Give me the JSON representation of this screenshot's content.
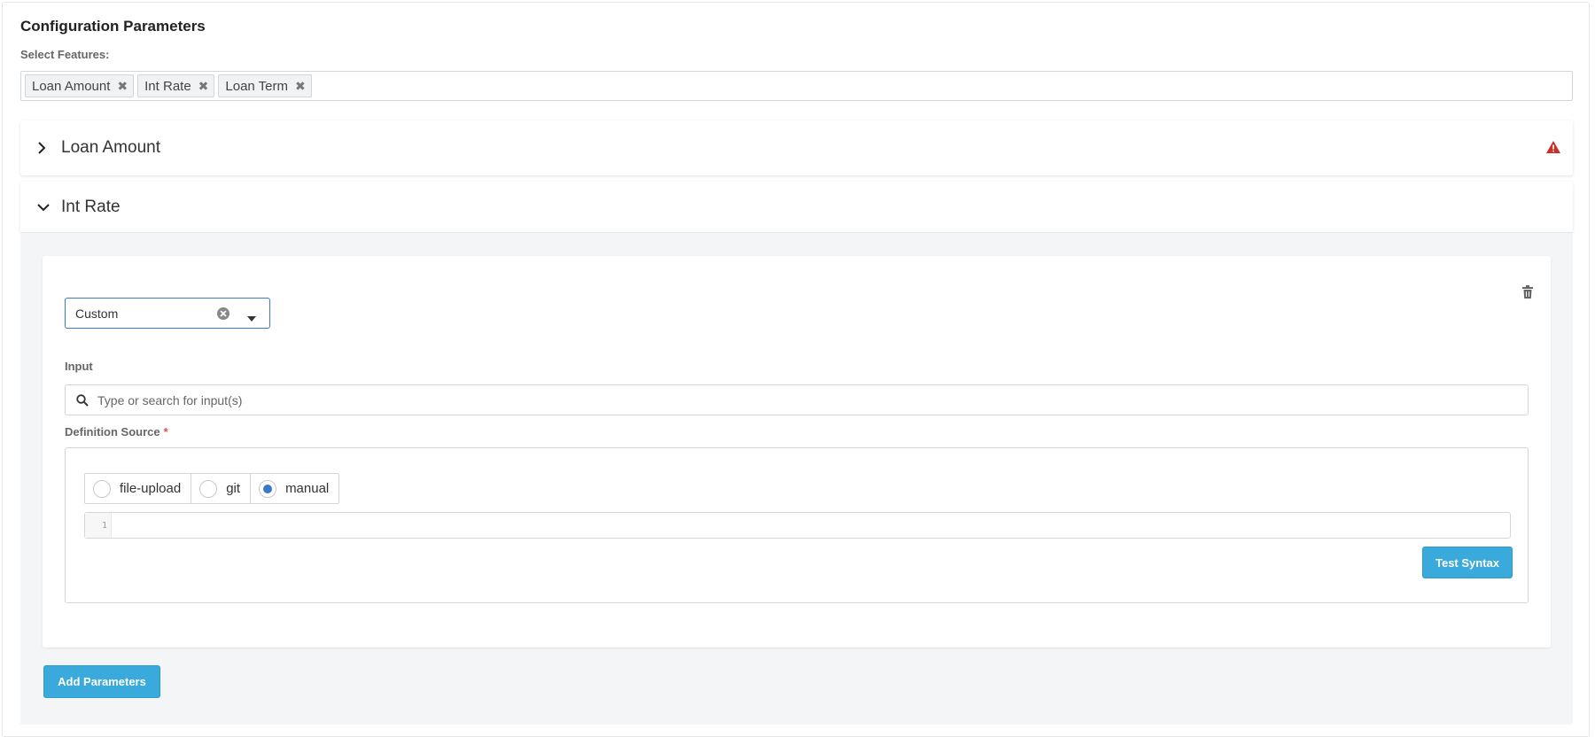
{
  "section": {
    "title": "Configuration Parameters",
    "select_label": "Select Features:"
  },
  "features": [
    {
      "label": "Loan Amount"
    },
    {
      "label": "Int Rate"
    },
    {
      "label": "Loan Term"
    }
  ],
  "panels": {
    "loan_amount": {
      "title": "Loan Amount",
      "expanded": false,
      "status_icon": "warning-icon",
      "status_color": "#c9302c"
    },
    "int_rate": {
      "title": "Int Rate",
      "expanded": true
    }
  },
  "param_card": {
    "type_select_value": "Custom",
    "input_label": "Input",
    "input_placeholder": "Type or search for input(s)",
    "definition_label": "Definition Source",
    "required_marker": "*",
    "sources": [
      {
        "label": "file-upload",
        "selected": false
      },
      {
        "label": "git",
        "selected": false
      },
      {
        "label": "manual",
        "selected": true
      }
    ],
    "editor_line_number": "1",
    "test_button": "Test Syntax"
  },
  "add_button": "Add Parameters",
  "colors": {
    "accent": "#3aa9dc",
    "focus_border": "#3a78c9",
    "warning": "#c9302c",
    "body_bg": "#f4f5f6"
  }
}
